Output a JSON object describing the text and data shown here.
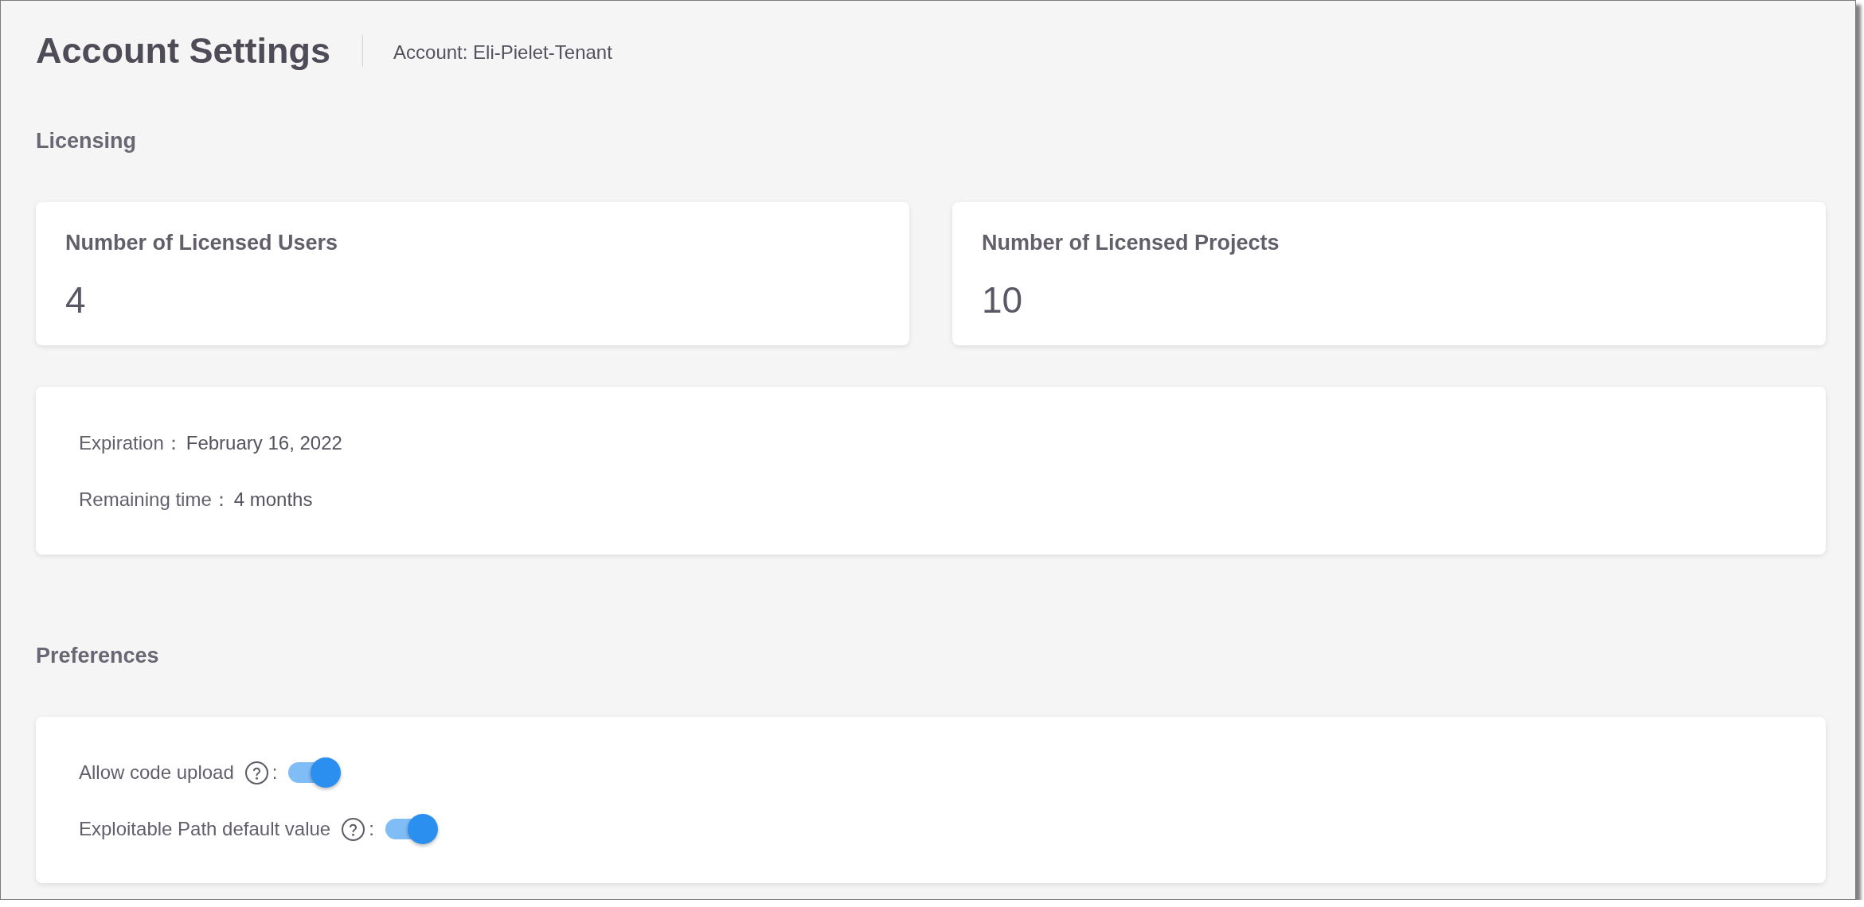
{
  "header": {
    "title": "Account Settings",
    "account": "Account: Eli-Pielet-Tenant"
  },
  "licensing": {
    "heading": "Licensing",
    "stats": [
      {
        "label": "Number of Licensed Users",
        "value": "4"
      },
      {
        "label": "Number of Licensed Projects",
        "value": "10"
      }
    ],
    "details": [
      {
        "label": "Expiration：",
        "value": "February 16, 2022"
      },
      {
        "label": "Remaining time：",
        "value": "4 months"
      }
    ]
  },
  "preferences": {
    "heading": "Preferences",
    "items": [
      {
        "label": "Allow code upload",
        "colon": ":",
        "on": true
      },
      {
        "label": "Exploitable Path default value",
        "colon": ":",
        "on": true
      }
    ]
  }
}
